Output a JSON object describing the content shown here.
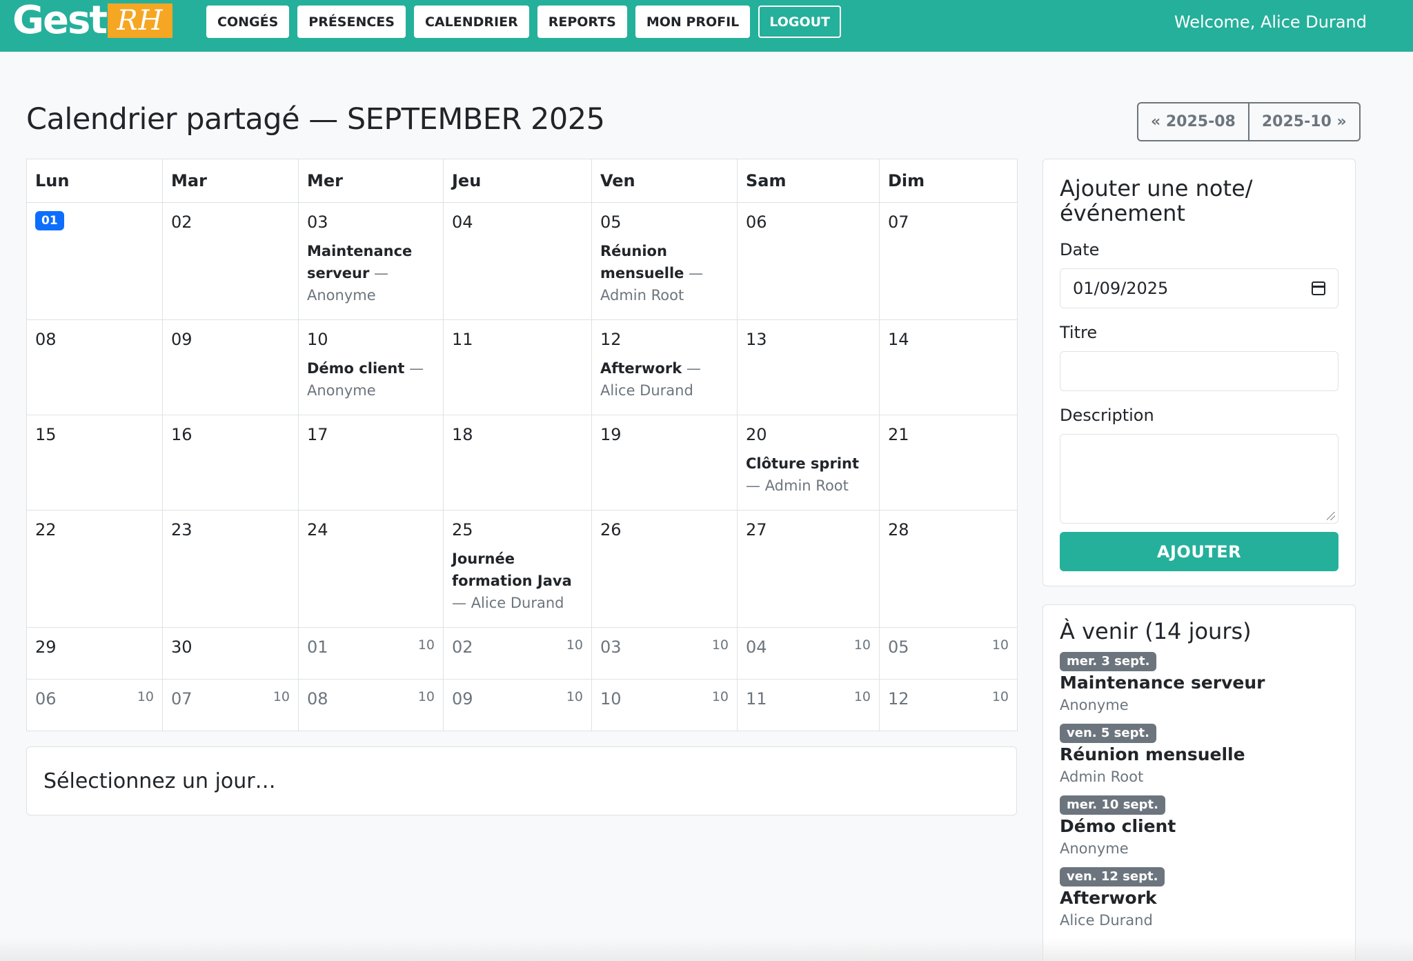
{
  "brand": {
    "part1": "Gest",
    "part2": "RH",
    "accent": "#f5a623",
    "primary": "#25b09b"
  },
  "nav": {
    "items": [
      "CONGÉS",
      "PRÉSENCES",
      "CALENDRIER",
      "REPORTS",
      "MON PROFIL"
    ],
    "logout": "LOGOUT",
    "welcome": "Welcome, Alice Durand"
  },
  "page": {
    "title": "Calendrier partagé — SEPTEMBER 2025",
    "prev_month": "« 2025-08",
    "next_month": "2025-10 »"
  },
  "calendar": {
    "weekdays": [
      "Lun",
      "Mar",
      "Mer",
      "Jeu",
      "Ven",
      "Sam",
      "Dim"
    ],
    "today": "01",
    "event_dash": "—",
    "week1": {
      "d1": "02",
      "d2": "03",
      "d3": "04",
      "d4": "05",
      "d5": "06",
      "d6": "07",
      "e2_title": "Maintenance serveur",
      "e2_author": "Anonyme",
      "e4_title": "Réunion mensuelle",
      "e4_author": "Admin Root"
    },
    "week2": {
      "d0": "08",
      "d1": "09",
      "d2": "10",
      "d3": "11",
      "d4": "12",
      "d5": "13",
      "d6": "14",
      "e2_title": "Démo client",
      "e2_author": "Anonyme",
      "e4_title": "Afterwork",
      "e4_author": "Alice Durand"
    },
    "week3": {
      "d0": "15",
      "d1": "16",
      "d2": "17",
      "d3": "18",
      "d4": "19",
      "d5": "20",
      "d6": "21",
      "e5_title": "Clôture sprint",
      "e5_author": "Admin Root"
    },
    "week4": {
      "d0": "22",
      "d1": "23",
      "d2": "24",
      "d3": "25",
      "d4": "26",
      "d5": "27",
      "d6": "28",
      "e3_title": "Journée formation Java",
      "e3_author": "Alice Durand"
    },
    "week5": {
      "d0": "29",
      "d1": "30",
      "d2": "01",
      "d3": "02",
      "d4": "03",
      "d5": "04",
      "d6": "05",
      "count": "10"
    },
    "week6": {
      "d0": "06",
      "d1": "07",
      "d2": "08",
      "d3": "09",
      "d4": "10",
      "d5": "11",
      "d6": "12",
      "count": "10"
    }
  },
  "select_day": "Sélectionnez un jour…",
  "form": {
    "title": "Ajouter une note/ événement",
    "date_label": "Date",
    "date_value": "01/09/2025",
    "title_label": "Titre",
    "title_value": "",
    "description_label": "Description",
    "submit": "AJOUTER"
  },
  "upcoming": {
    "title": "À venir (14 jours)",
    "items": [
      {
        "date": "mer. 3 sept.",
        "title": "Maintenance serveur",
        "author": "Anonyme"
      },
      {
        "date": "ven. 5 sept.",
        "title": "Réunion mensuelle",
        "author": "Admin Root"
      },
      {
        "date": "mer. 10 sept.",
        "title": "Démo client",
        "author": "Anonyme"
      },
      {
        "date": "ven. 12 sept.",
        "title": "Afterwork",
        "author": "Alice Durand"
      }
    ]
  }
}
